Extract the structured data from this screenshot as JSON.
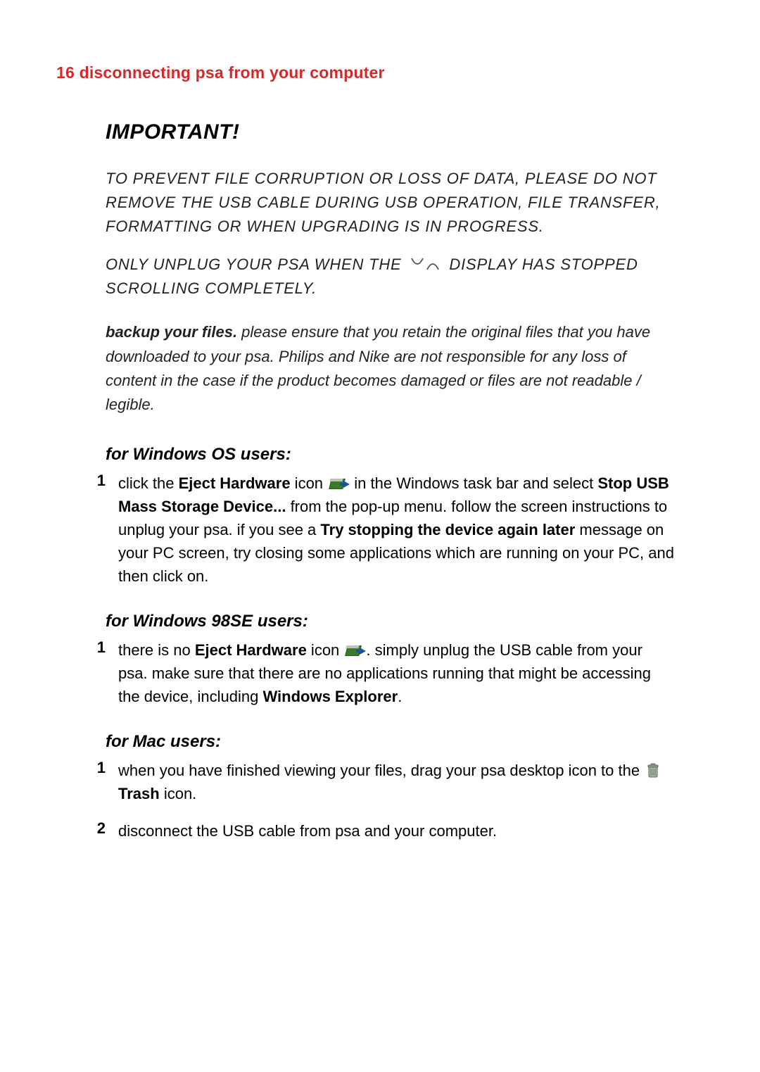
{
  "header": {
    "page_number": "16",
    "title": "disconnecting psa from your computer"
  },
  "important": {
    "title": "IMPORTANT!",
    "para1": "TO PREVENT FILE CORRUPTION OR LOSS OF DATA, PLEASE DO NOT REMOVE THE USB CABLE DURING USB OPERATION, FILE TRANSFER, FORMATTING OR WHEN UPGRADING IS IN PROGRESS.",
    "para2_a": "ONLY UNPLUG YOUR PSA WHEN THE",
    "para2_b": "DISPLAY HAS STOPPED SCROLLING COMPLETELY.",
    "backup_strong": "backup your files.",
    "backup_rest": " please ensure that you retain the original files that you have downloaded to your psa. Philips and Nike are not responsible for any loss of content in the case if the product becomes damaged or files are not readable / legible."
  },
  "sections": {
    "win": {
      "heading": "for Windows OS users:",
      "step1": {
        "num": "1",
        "a": "click the ",
        "b_bold": "Eject Hardware",
        "c": " icon ",
        "d": " in the Windows task bar and select ",
        "e_bold": "Stop USB Mass Storage Device...",
        "f": " from the pop-up menu. follow the screen instructions to unplug your psa. if you see a ",
        "g_bold": "Try stopping the device again later",
        "h": " message on your PC screen, try closing some applications which are running on your PC, and then click on."
      }
    },
    "win98": {
      "heading": "for Windows 98SE users:",
      "step1": {
        "num": "1",
        "a": "there is no ",
        "b_bold": "Eject Hardware",
        "c": " icon ",
        "d": ". simply unplug the USB cable from your psa. make sure that there are no applications running that might be accessing the device, including ",
        "e_bold": "Windows Explorer",
        "f": "."
      }
    },
    "mac": {
      "heading": "for Mac users:",
      "step1": {
        "num": "1",
        "a": "when you have finished viewing your files, drag your psa desktop icon to the ",
        "b_bold": "Trash",
        "c": " icon."
      },
      "step2": {
        "num": "2",
        "a": "disconnect the USB cable from psa and your computer."
      }
    }
  }
}
